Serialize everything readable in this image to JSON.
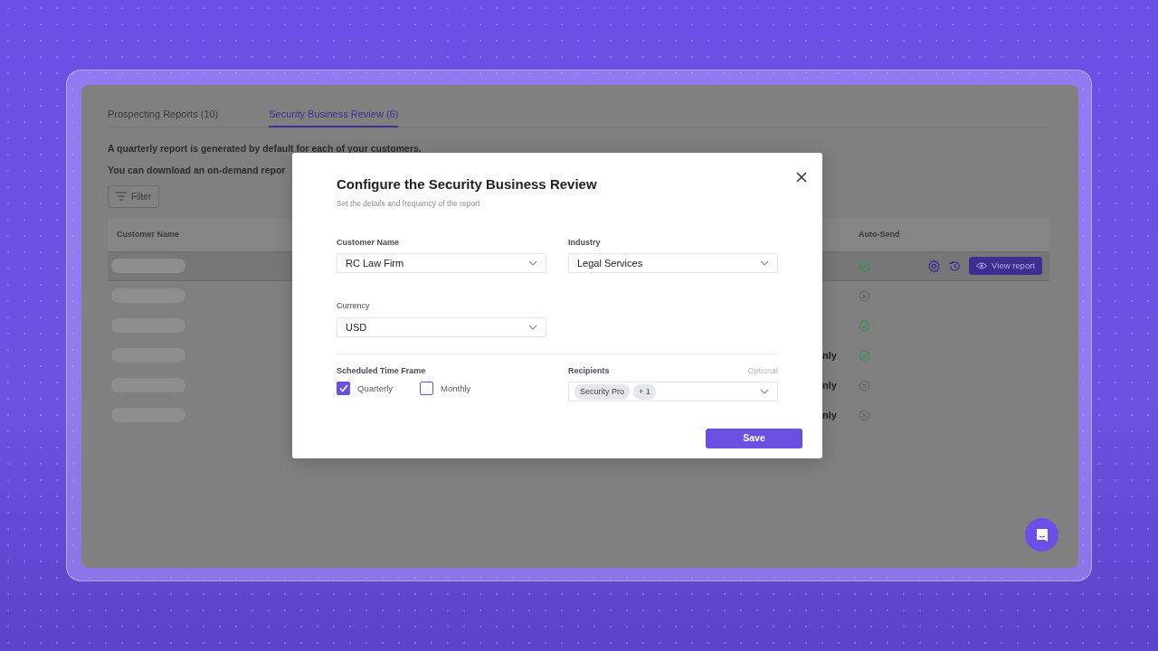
{
  "tabs": [
    {
      "label": "Prospecting Reports (10)",
      "selected": false
    },
    {
      "label": "Security Business Review (6)",
      "selected": true
    }
  ],
  "intro_lines": [
    "A quarterly report is generated by default for each of your customers.",
    "You can download an on-demand repor"
  ],
  "filter_button": {
    "label": "Filter"
  },
  "table": {
    "columns": [
      "Customer Name",
      "Auto-Send"
    ],
    "rows": [
      {
        "selected": true,
        "auto_send": true,
        "view_button": "View report"
      },
      {
        "selected": false,
        "auto_send": false
      },
      {
        "selected": false,
        "auto_send": true
      },
      {
        "selected": false,
        "column_2": "nly",
        "auto_send": true
      },
      {
        "selected": false,
        "column_2": "nly",
        "auto_send": false
      },
      {
        "selected": false,
        "column_2": "nly",
        "auto_send": false
      }
    ]
  },
  "modal": {
    "title": "Configure the Security Business Review",
    "subtitle": "Set the details and frequency of the report",
    "fields": [
      {
        "label": "Customer Name",
        "value": "RC Law Firm"
      },
      {
        "label": "Industry",
        "value": "Legal Services"
      },
      {
        "label": "Currency",
        "value": "USD"
      }
    ],
    "time_frame": {
      "label": "Scheduled Time Frame",
      "options": [
        {
          "label": "Quarterly",
          "checked": true
        },
        {
          "label": "Monthly",
          "checked": false
        }
      ]
    },
    "recipients": {
      "label": "Recipients",
      "hint": "Optional",
      "chips": [
        "Security Pro",
        "+ 1"
      ]
    },
    "save_button": "Save"
  }
}
